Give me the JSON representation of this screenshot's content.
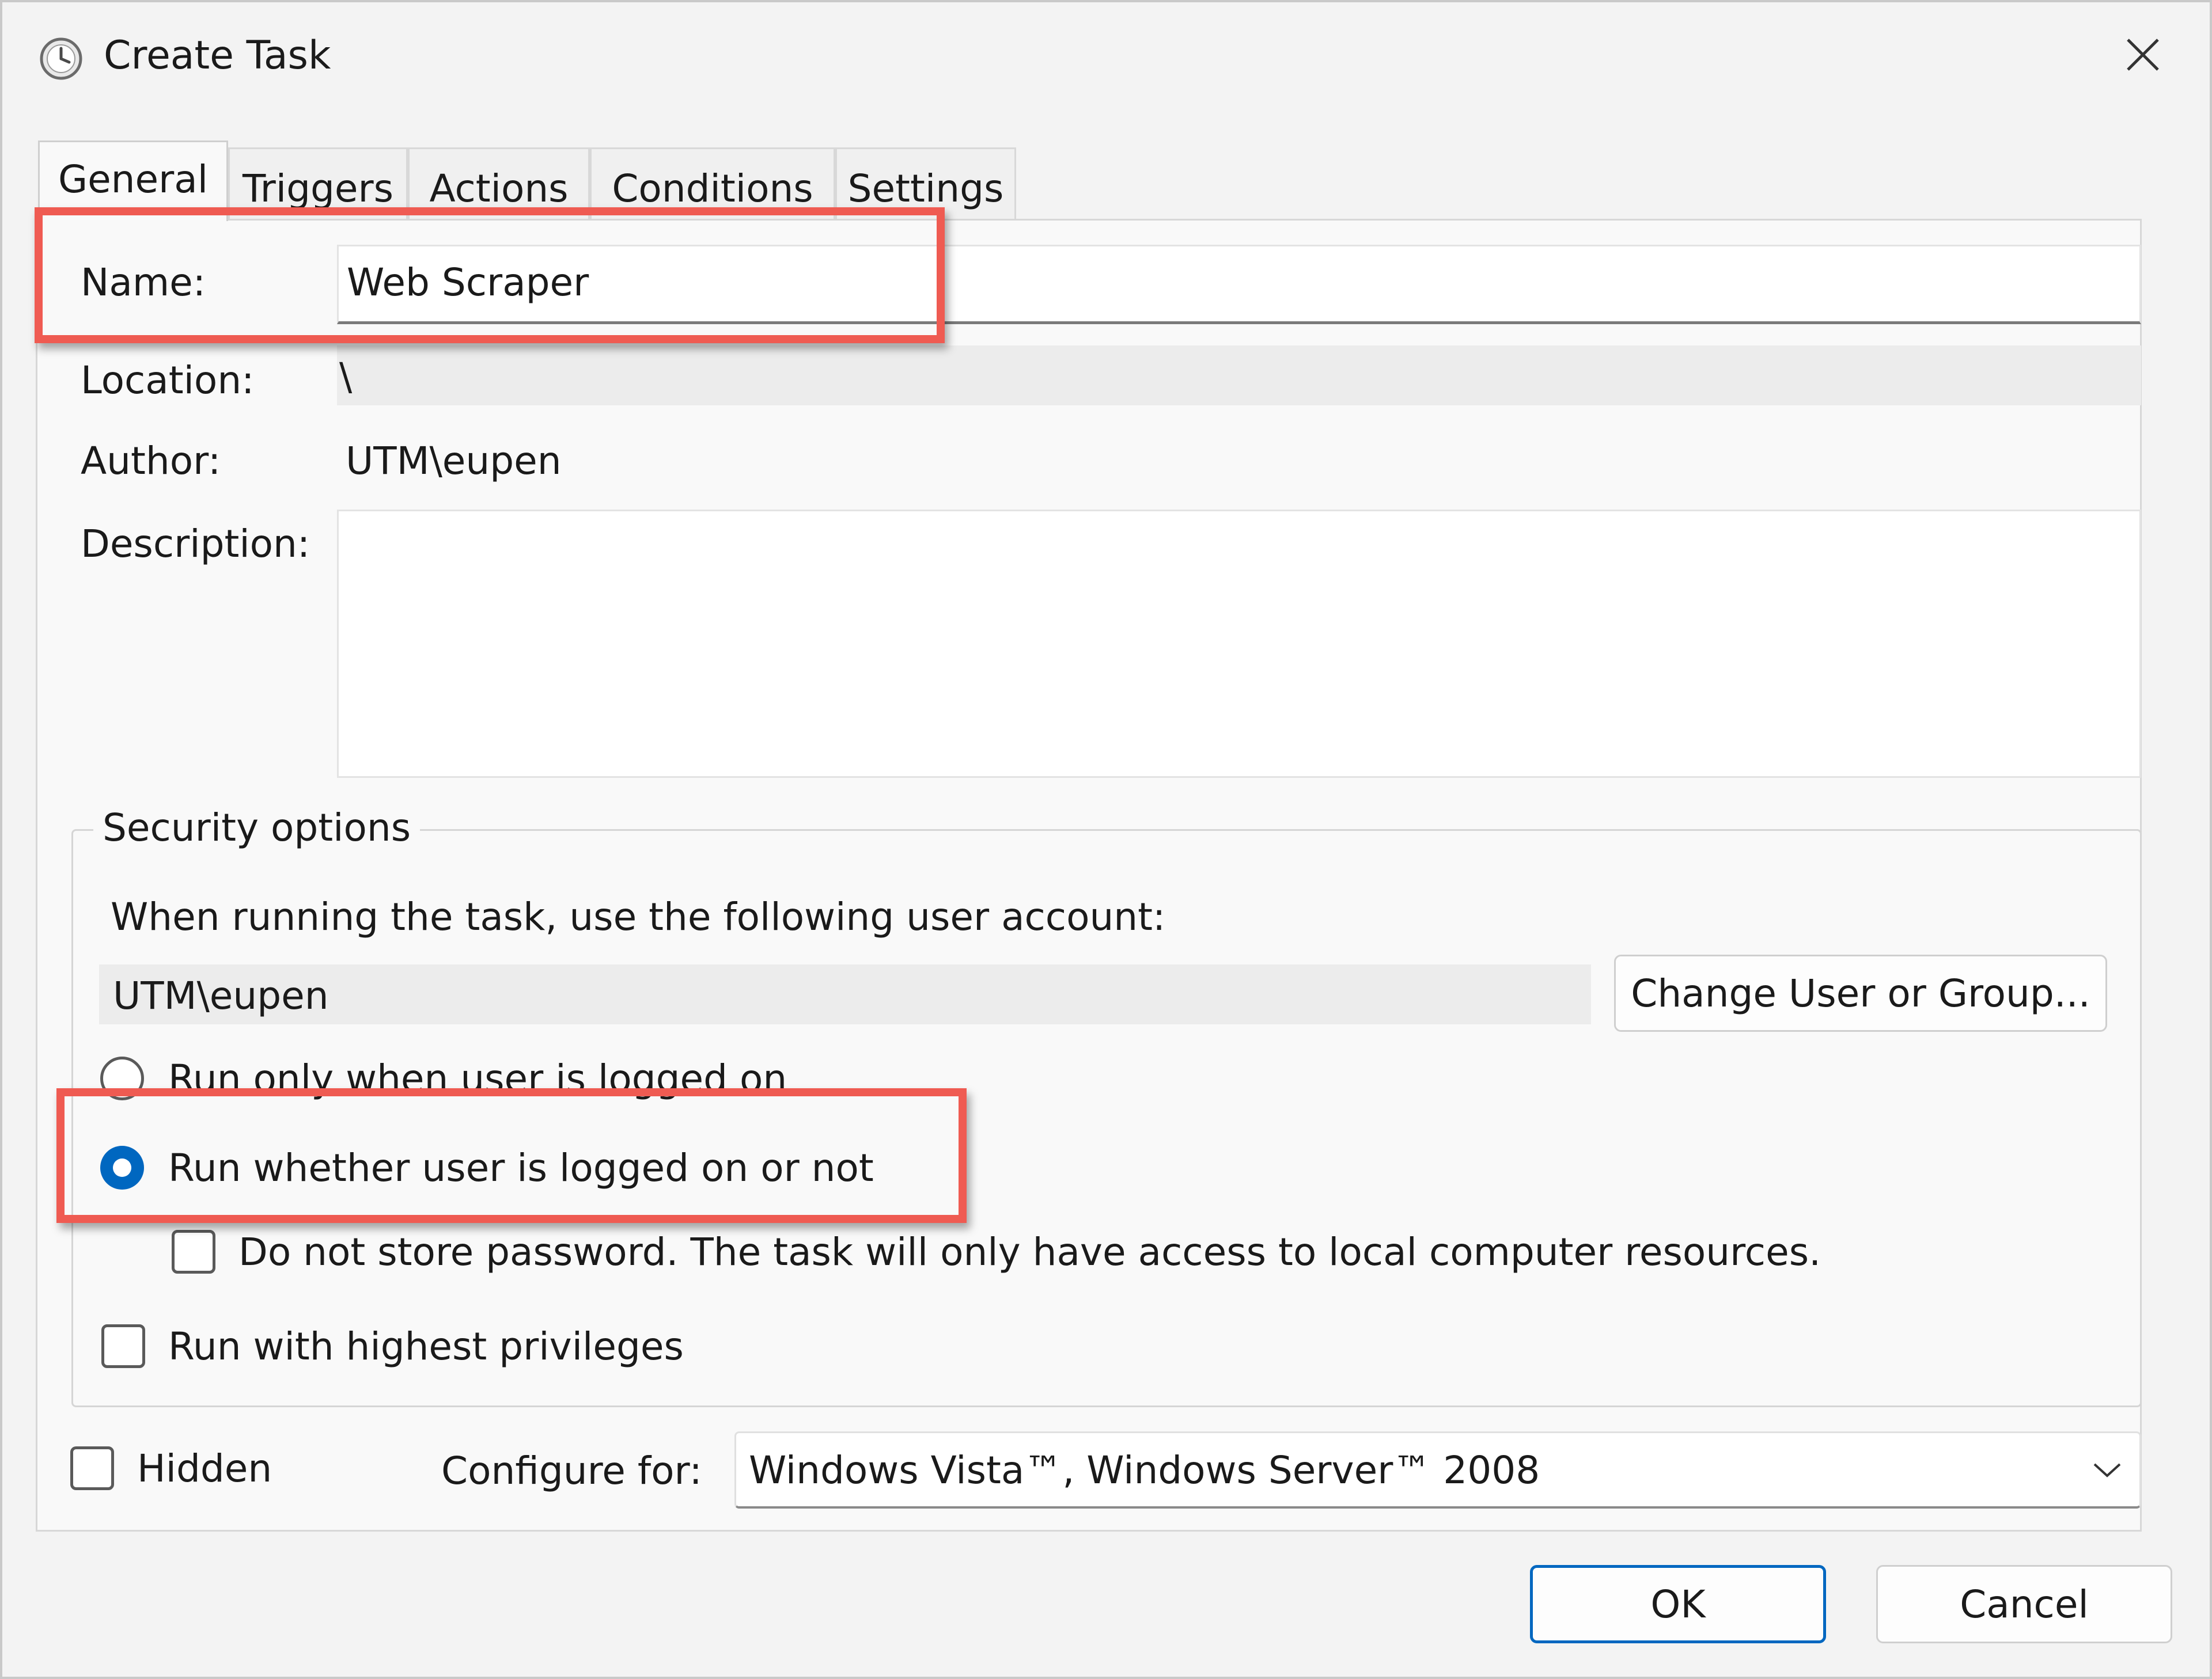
{
  "window": {
    "title": "Create Task",
    "title_icon": "clock-icon",
    "close_icon": "close-icon"
  },
  "tabs": [
    {
      "label": "General",
      "active": true
    },
    {
      "label": "Triggers",
      "active": false
    },
    {
      "label": "Actions",
      "active": false
    },
    {
      "label": "Conditions",
      "active": false
    },
    {
      "label": "Settings",
      "active": false
    }
  ],
  "general": {
    "name_label": "Name:",
    "name_value": "Web Scraper",
    "location_label": "Location:",
    "location_value": "\\",
    "author_label": "Author:",
    "author_value": "UTM\\eupen",
    "description_label": "Description:",
    "description_value": ""
  },
  "security": {
    "group_label": "Security options",
    "account_prompt": "When running the task, use the following user account:",
    "account_value": "UTM\\eupen",
    "change_button": "Change User or Group...",
    "radio_logged_on": "Run only when user is logged on",
    "radio_whether": "Run whether user is logged on or not",
    "selected_radio": "whether",
    "do_not_store": "Do not store password.  The task will only have access to local computer resources.",
    "do_not_store_checked": false,
    "highest_privileges": "Run with highest privileges",
    "highest_privileges_checked": false
  },
  "footer": {
    "hidden_label": "Hidden",
    "hidden_checked": false,
    "configure_label": "Configure for:",
    "configure_value": "Windows Vista™, Windows Server™ 2008",
    "ok_button": "OK",
    "cancel_button": "Cancel"
  },
  "colors": {
    "accent": "#0067c0",
    "highlight": "#ef5b52",
    "background": "#f3f3f3"
  }
}
